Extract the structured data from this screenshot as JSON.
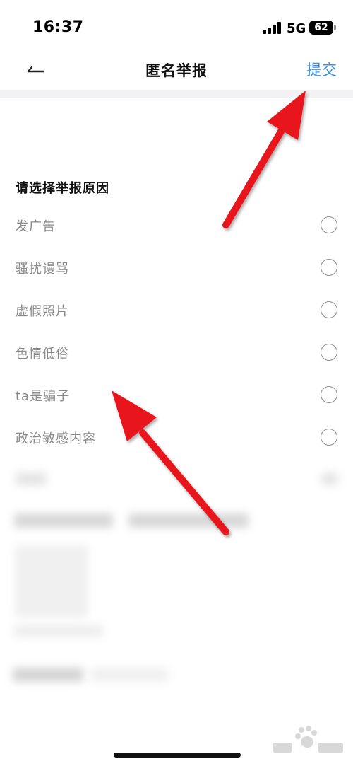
{
  "status": {
    "time": "16:37",
    "network": "5G",
    "battery": "62"
  },
  "nav": {
    "title": "匿名举报",
    "submit_label": "提交"
  },
  "section_title": "请选择举报原因",
  "reasons": [
    {
      "label": "发广告"
    },
    {
      "label": "骚扰谩骂"
    },
    {
      "label": "虚假照片"
    },
    {
      "label": "色情低俗"
    },
    {
      "label": "ta是骗子"
    },
    {
      "label": "政治敏感内容"
    }
  ],
  "colors": {
    "accent": "#3a8ee6",
    "annotation_arrow": "#e8161b"
  },
  "icons": {
    "back": "arrow-left-icon",
    "radio": "radio-unchecked-icon"
  }
}
